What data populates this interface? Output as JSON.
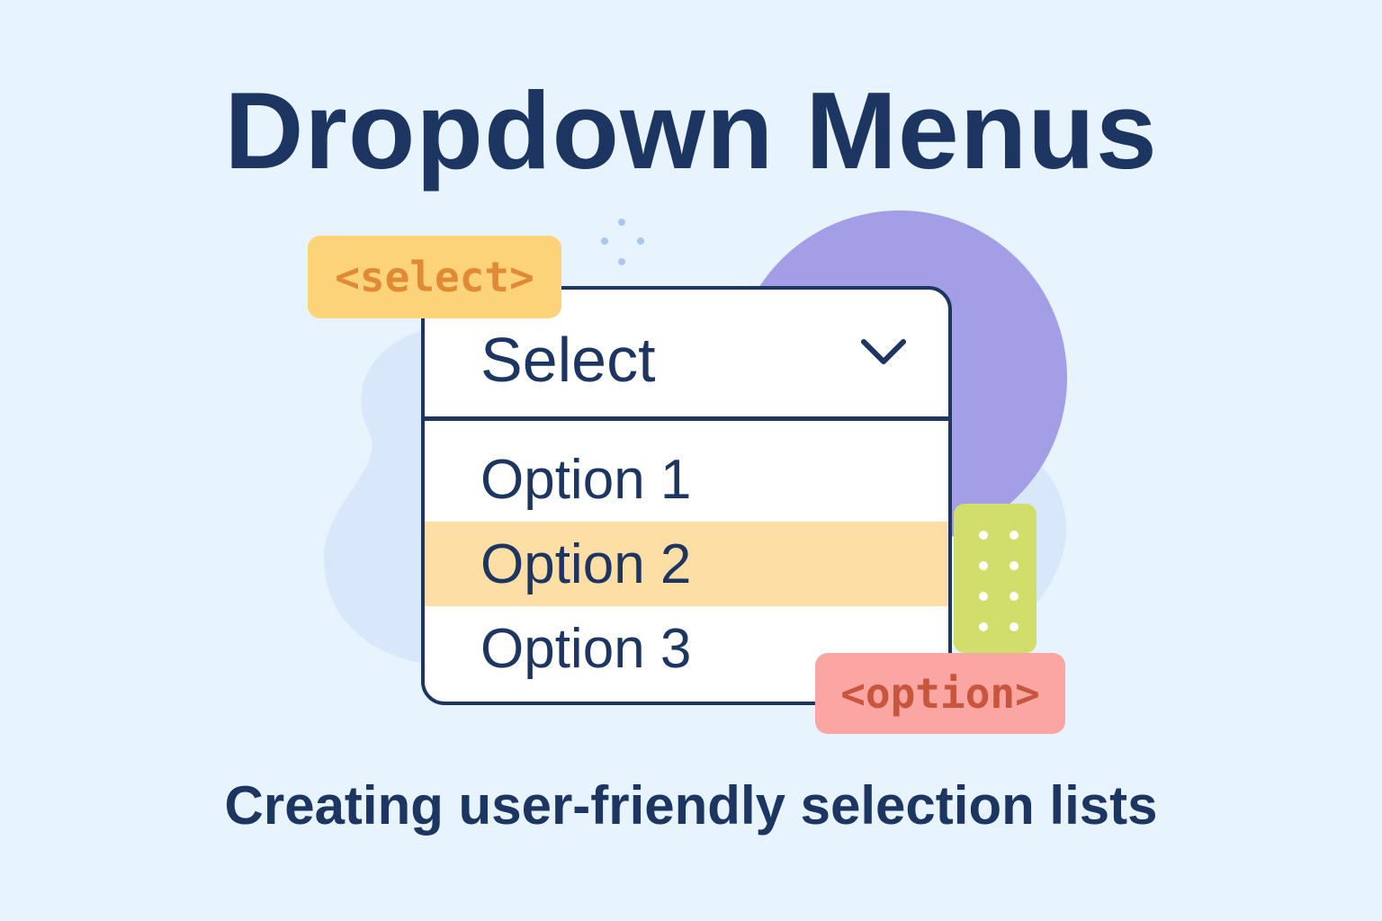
{
  "title": "Dropdown Menus",
  "subtitle": "Creating user-friendly selection lists",
  "dropdown": {
    "value": "Select",
    "toggle_icon": "chevron-down-icon",
    "options": [
      {
        "label": "Option 1",
        "selected": false
      },
      {
        "label": "Option 2",
        "selected": true
      },
      {
        "label": "Option 3",
        "selected": false
      }
    ]
  },
  "tags": {
    "select": "<select>",
    "option": "<option>"
  },
  "colors": {
    "background": "#e7f3fd",
    "text": "#1c3561",
    "purple_circle": "#a39ee5",
    "light_blob": "#d8e8fa",
    "highlight": "#fddea4",
    "select_tag_bg": "#fdd37a",
    "select_tag_text": "#e08a35",
    "option_tag_bg": "#fba6a3",
    "option_tag_text": "#c8553e",
    "green_card": "#d2de6b"
  }
}
